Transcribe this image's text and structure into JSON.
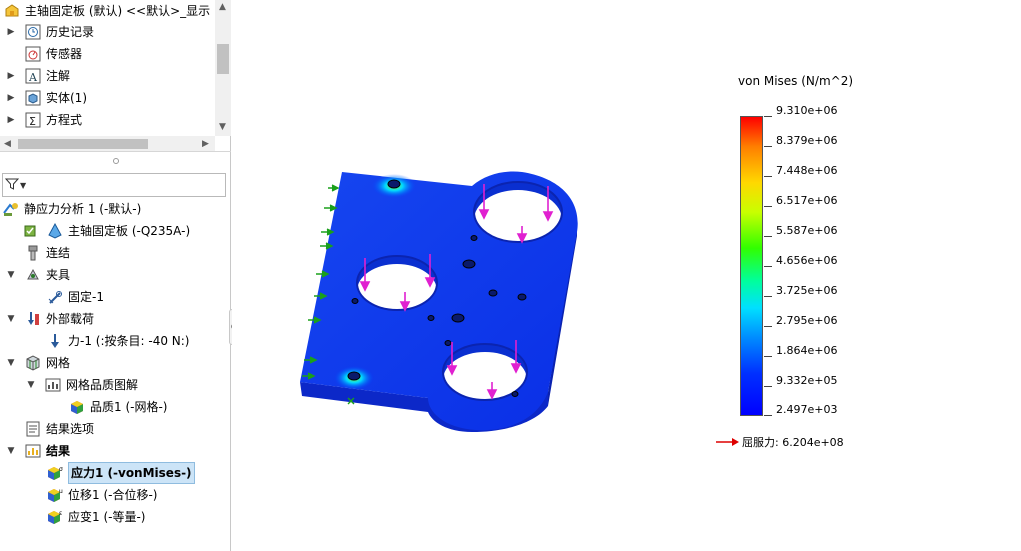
{
  "feature_tree": {
    "part_title": "主轴固定板 (默认) <<默认>_显示",
    "items": [
      {
        "label": "历史记录"
      },
      {
        "label": "传感器"
      },
      {
        "label": "注解"
      },
      {
        "label": "实体(1)"
      },
      {
        "label": "方程式"
      }
    ]
  },
  "simulation_tree": {
    "study": "静应力分析 1 (-默认-)",
    "part": "主轴固定板 (-Q235A-)",
    "connections": "连结",
    "fixtures": "夹具",
    "fixture_1": "固定-1",
    "external_loads": "外部载荷",
    "force_1": "力-1 (:按条目: -40 N:)",
    "mesh": "网格",
    "mesh_quality_plot": "网格品质图解",
    "quality_1": "品质1 (-网格-)",
    "result_options": "结果选项",
    "results": "结果",
    "stress_1": "应力1 (-vonMises-)",
    "displacement_1": "位移1 (-合位移-)",
    "strain_1": "应变1 (-等量-)"
  },
  "legend": {
    "title": "von Mises (N/m^2)",
    "ticks": [
      "9.310e+06",
      "8.379e+06",
      "7.448e+06",
      "6.517e+06",
      "5.587e+06",
      "4.656e+06",
      "3.725e+06",
      "2.795e+06",
      "1.864e+06",
      "9.332e+05",
      "2.497e+03"
    ],
    "yield_label": "屈服力: 6.204e+08",
    "colors": {
      "max": "#ff0000",
      "min": "#0000ff",
      "yield_arrow": "#dd0000"
    }
  },
  "icons": {
    "part": "part-folder-icon",
    "history": "history-icon",
    "sensor": "sensor-icon",
    "annotation": "annotation-icon",
    "solid_body": "solid-body-icon",
    "equation": "equation-icon",
    "filter": "filter-icon"
  }
}
